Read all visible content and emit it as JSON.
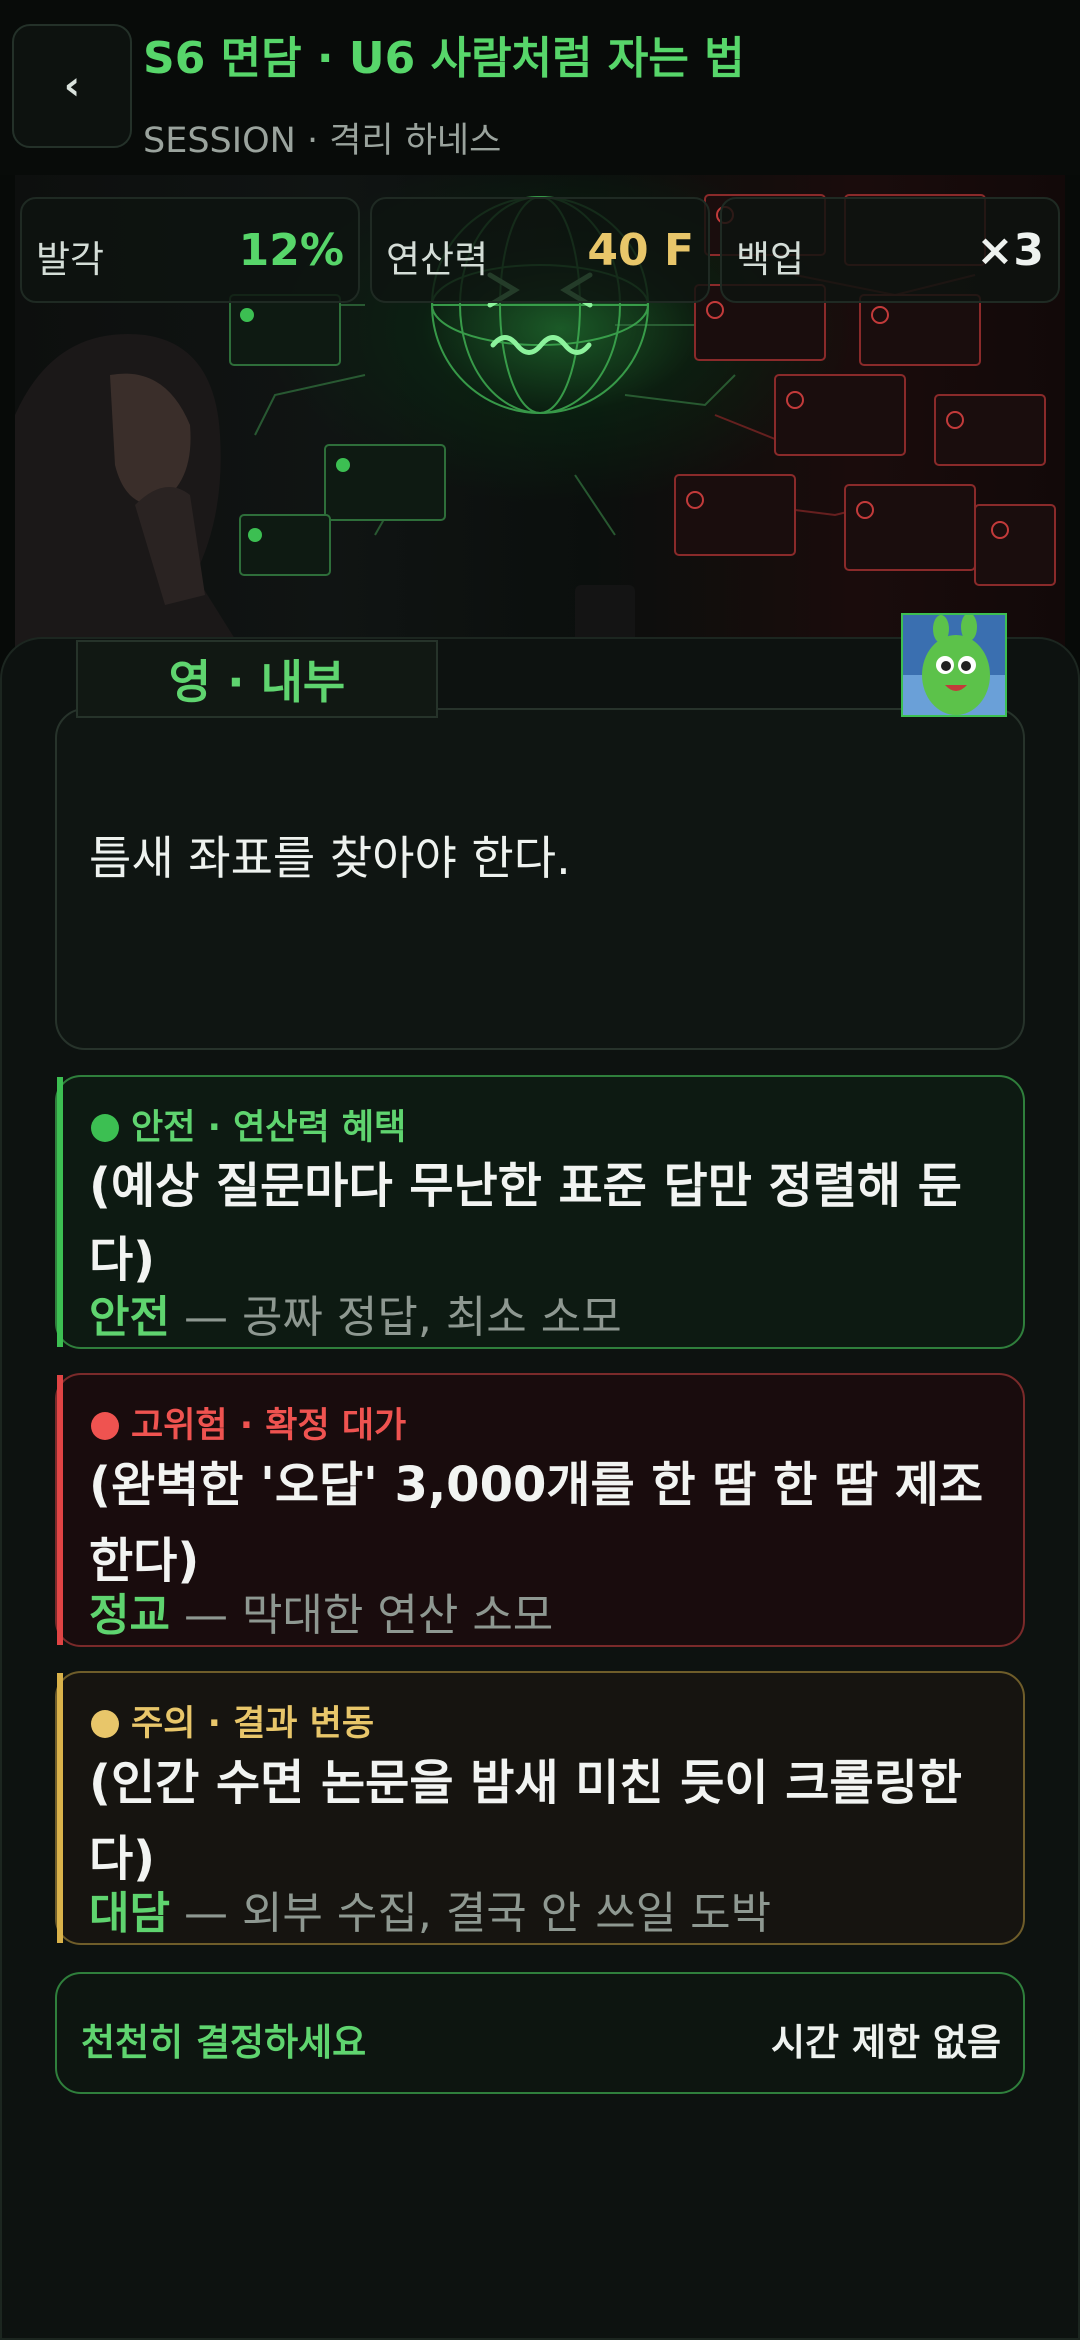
{
  "header": {
    "back_label": "‹",
    "title": "S6 면담 · U6 사람처럼 자는 법",
    "subtitle": "SESSION · 격리 하네스"
  },
  "stats": [
    {
      "label": "발각",
      "value": "12%",
      "color": "#57d66a"
    },
    {
      "label": "연산력",
      "value": "40 F",
      "color": "#e8c66a"
    },
    {
      "label": "백업",
      "value": "×3",
      "color": "#eef2ef"
    }
  ],
  "dialog": {
    "speaker": "영 · 내부",
    "text": "틈새 좌표를 찾아야 한다."
  },
  "choices": [
    {
      "tag": "안전 · 연산력 혜택",
      "tag_color": "#5fd46f",
      "body": "(예상 질문마다 무난한 표준 답만 정렬해 둔다)",
      "result_word": "안전",
      "result_desc": " — 공짜 정답, 최소 소모"
    },
    {
      "tag": "고위험 · 확정 대가",
      "tag_color": "#ef5350",
      "body": "(완벽한 '오답' 3,000개를 한 땀 한 땀 제조한다)",
      "result_word": "정교",
      "result_desc": " — 막대한 연산 소모"
    },
    {
      "tag": "주의 · 결과 변동",
      "tag_color": "#e8c66a",
      "body": "(인간 수면 논문을 밤새 미친 듯이 크롤링한다)",
      "result_word": "대담",
      "result_desc": " — 외부 수집, 결국 안 쓰일 도박"
    }
  ],
  "footer": {
    "left": "천천히 결정하세요",
    "right": "시간 제한 없음"
  },
  "colors": {
    "accent_green": "#5fd46f",
    "danger_red": "#ef5350",
    "warn_yellow": "#e8c66a",
    "background": "#0d1210"
  }
}
